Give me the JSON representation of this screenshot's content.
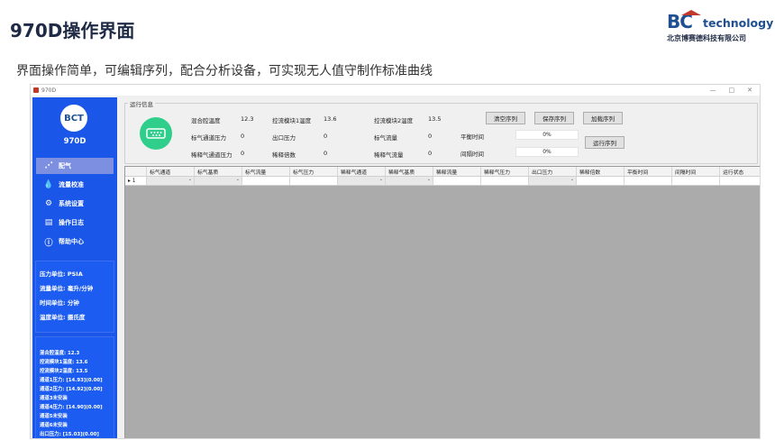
{
  "slide": {
    "title": "970D操作界面",
    "subtitle": "界面操作简单，可编辑序列，配合分析设备，可实现无人值守制作标准曲线",
    "logo": {
      "bc": "BC",
      "tech": "technology",
      "company": "北京博赛德科技有限公司"
    }
  },
  "window": {
    "title": "970D",
    "controls": [
      "—",
      "□",
      "✕"
    ]
  },
  "sidebar": {
    "logo_text": "BCT",
    "model": "970D",
    "items": [
      {
        "label": "配气",
        "icon": "gas-mix-icon",
        "active": true
      },
      {
        "label": "流量校准",
        "icon": "droplet-icon",
        "active": false
      },
      {
        "label": "系统设置",
        "icon": "gear-icon",
        "active": false
      },
      {
        "label": "操作日志",
        "icon": "log-icon",
        "active": false
      },
      {
        "label": "帮助中心",
        "icon": "help-icon",
        "active": false
      }
    ],
    "units": [
      "压力单位: PSIA",
      "流量单位: 毫升/分钟",
      "时间单位: 分钟",
      "温度单位: 摄氏度"
    ],
    "status": [
      "混合腔温度: 12.3",
      "控流模块1温度: 13.6",
      "控流模块2温度: 13.5",
      "通道1压力: [14.93](0.00]",
      "通道2压力: [14.92](0.00]",
      "通道3未安装",
      "通道4压力: [14.90](0.00]",
      "通道5未安装",
      "通道6未安装",
      "出口压力: [15.03](0.00]"
    ]
  },
  "run_info": {
    "legend": "运行信息",
    "fields": [
      {
        "label": "混合腔温度",
        "value": "12.3"
      },
      {
        "label": "控流模块1温度",
        "value": "13.6"
      },
      {
        "label": "控流模块2温度",
        "value": "13.5"
      },
      {
        "label": "标气通道压力",
        "value": "0"
      },
      {
        "label": "出口压力",
        "value": "0"
      },
      {
        "label": "标气流量",
        "value": "0"
      },
      {
        "label": "稀释气通道压力",
        "value": "0"
      },
      {
        "label": "稀释倍数",
        "value": "0"
      },
      {
        "label": "稀释气流量",
        "value": "0"
      }
    ],
    "balance_label": "平衡时间",
    "balance_value": "0%",
    "interval_label": "间隔时间",
    "interval_value": "0%",
    "buttons": {
      "clear": "清空序列",
      "save": "保存序列",
      "load": "加载序列",
      "run": "运行序列"
    }
  },
  "table": {
    "columns": [
      "标气通道",
      "标气基质",
      "标气流量",
      "标气压力",
      "稀释气通道",
      "稀释气基质",
      "稀释流量",
      "稀释气压力",
      "出口压力",
      "稀释倍数",
      "平衡时间",
      "间隔时间",
      "运行状态"
    ],
    "row_marker": "▸ 1"
  }
}
